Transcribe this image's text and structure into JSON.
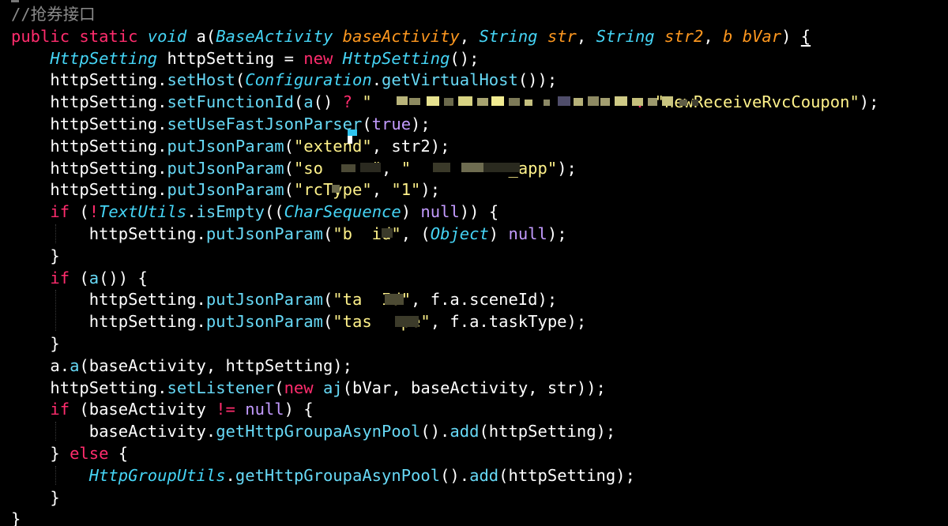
{
  "editor": {
    "background": "#000000",
    "colors": {
      "comment": "#8a8a8a",
      "keyword": "#ff2c6d",
      "type": "#45d4f5",
      "method": "#67d9f6",
      "param": "#fd971f",
      "string": "#fff28a",
      "literal": "#c39bff",
      "plain": "#ffffff"
    },
    "lines": [
      {
        "tokens": [
          {
            "t": "//抢券接口",
            "c": "comment"
          }
        ]
      },
      {
        "tokens": [
          {
            "t": "public static ",
            "c": "keyword"
          },
          {
            "t": "void ",
            "c": "type"
          },
          {
            "t": "a",
            "c": "plain"
          },
          {
            "t": "(",
            "c": "plain"
          },
          {
            "t": "BaseActivity ",
            "c": "type"
          },
          {
            "t": "baseActivity",
            "c": "param"
          },
          {
            "t": ", ",
            "c": "plain"
          },
          {
            "t": "String ",
            "c": "type"
          },
          {
            "t": "str",
            "c": "param"
          },
          {
            "t": ", ",
            "c": "plain"
          },
          {
            "t": "String ",
            "c": "type"
          },
          {
            "t": "str2",
            "c": "param"
          },
          {
            "t": ", ",
            "c": "plain"
          },
          {
            "t": "b ",
            "c": "param"
          },
          {
            "t": "bVar",
            "c": "param"
          },
          {
            "t": ") ",
            "c": "plain"
          },
          {
            "t": "{",
            "c": "plain",
            "u": true
          }
        ]
      },
      {
        "tokens": [
          {
            "t": "    ",
            "c": "plain"
          },
          {
            "t": "HttpSetting ",
            "c": "type"
          },
          {
            "t": "httpSetting = ",
            "c": "plain"
          },
          {
            "t": "new ",
            "c": "keyword"
          },
          {
            "t": "HttpSetting",
            "c": "type"
          },
          {
            "t": "();",
            "c": "plain"
          }
        ]
      },
      {
        "tokens": [
          {
            "t": "    httpSetting.",
            "c": "plain"
          },
          {
            "t": "setHost",
            "c": "method"
          },
          {
            "t": "(",
            "c": "plain"
          },
          {
            "t": "Configuration",
            "c": "type"
          },
          {
            "t": ".",
            "c": "plain"
          },
          {
            "t": "getVirtualHost",
            "c": "method"
          },
          {
            "t": "());",
            "c": "plain"
          }
        ]
      },
      {
        "tokens": [
          {
            "t": "    httpSetting.",
            "c": "plain"
          },
          {
            "t": "setFunctionId",
            "c": "method"
          },
          {
            "t": "(",
            "c": "plain"
          },
          {
            "t": "a",
            "c": "method"
          },
          {
            "t": "() ",
            "c": "plain"
          },
          {
            "t": "? ",
            "c": "keyword"
          },
          {
            "t": "\"                           ",
            "c": "string"
          },
          {
            "t": ": ",
            "c": "keyword"
          },
          {
            "t": "\"newReceiveRvcCoupon\"",
            "c": "string"
          },
          {
            "t": ");",
            "c": "plain"
          }
        ]
      },
      {
        "tokens": [
          {
            "t": "    httpSetting.",
            "c": "plain"
          },
          {
            "t": "setUseFastJsonParser",
            "c": "method"
          },
          {
            "t": "(",
            "c": "plain"
          },
          {
            "t": "true",
            "c": "literal"
          },
          {
            "t": ");",
            "c": "plain"
          }
        ]
      },
      {
        "tokens": [
          {
            "t": "    httpSetting.",
            "c": "plain"
          },
          {
            "t": "putJsonParam",
            "c": "method"
          },
          {
            "t": "(",
            "c": "plain"
          },
          {
            "t": "\"extend\"",
            "c": "string"
          },
          {
            "t": ", str2);",
            "c": "plain"
          }
        ]
      },
      {
        "tokens": [
          {
            "t": "    httpSetting.",
            "c": "plain"
          },
          {
            "t": "putJsonParam",
            "c": "method"
          },
          {
            "t": "(",
            "c": "plain"
          },
          {
            "t": "\"so     \"",
            "c": "string"
          },
          {
            "t": ", ",
            "c": "plain"
          },
          {
            "t": "\"          _app\"",
            "c": "string"
          },
          {
            "t": ");",
            "c": "plain"
          }
        ]
      },
      {
        "tokens": [
          {
            "t": "    httpSetting.",
            "c": "plain"
          },
          {
            "t": "putJsonParam",
            "c": "method"
          },
          {
            "t": "(",
            "c": "plain"
          },
          {
            "t": "\"rcType\"",
            "c": "string"
          },
          {
            "t": ", ",
            "c": "plain"
          },
          {
            "t": "\"1\"",
            "c": "string"
          },
          {
            "t": ");",
            "c": "plain"
          }
        ]
      },
      {
        "tokens": [
          {
            "t": "    ",
            "c": "plain"
          },
          {
            "t": "if ",
            "c": "keyword"
          },
          {
            "t": "(",
            "c": "plain"
          },
          {
            "t": "!",
            "c": "keyword"
          },
          {
            "t": "TextUtils",
            "c": "type"
          },
          {
            "t": ".",
            "c": "plain"
          },
          {
            "t": "isEmpty",
            "c": "method"
          },
          {
            "t": "((",
            "c": "plain"
          },
          {
            "t": "CharSequence",
            "c": "type"
          },
          {
            "t": ") ",
            "c": "plain"
          },
          {
            "t": "null",
            "c": "literal"
          },
          {
            "t": ")) {",
            "c": "plain"
          }
        ]
      },
      {
        "tokens": [
          {
            "t": "        httpSetting.",
            "c": "plain"
          },
          {
            "t": "putJsonParam",
            "c": "method"
          },
          {
            "t": "(",
            "c": "plain"
          },
          {
            "t": "\"b  id\"",
            "c": "string"
          },
          {
            "t": ", (",
            "c": "plain"
          },
          {
            "t": "Object",
            "c": "type"
          },
          {
            "t": ") ",
            "c": "plain"
          },
          {
            "t": "null",
            "c": "literal"
          },
          {
            "t": ");",
            "c": "plain"
          }
        ]
      },
      {
        "tokens": [
          {
            "t": "    }",
            "c": "plain"
          }
        ]
      },
      {
        "tokens": [
          {
            "t": "    ",
            "c": "plain"
          },
          {
            "t": "if ",
            "c": "keyword"
          },
          {
            "t": "(",
            "c": "plain"
          },
          {
            "t": "a",
            "c": "method"
          },
          {
            "t": "()) {",
            "c": "plain"
          }
        ]
      },
      {
        "tokens": [
          {
            "t": "        httpSetting.",
            "c": "plain"
          },
          {
            "t": "putJsonParam",
            "c": "method"
          },
          {
            "t": "(",
            "c": "plain"
          },
          {
            "t": "\"ta  Id\"",
            "c": "string"
          },
          {
            "t": ", f.a.sceneId);",
            "c": "plain"
          }
        ]
      },
      {
        "tokens": [
          {
            "t": "        httpSetting.",
            "c": "plain"
          },
          {
            "t": "putJsonParam",
            "c": "method"
          },
          {
            "t": "(",
            "c": "plain"
          },
          {
            "t": "\"tas   pe\"",
            "c": "string"
          },
          {
            "t": ", f.a.taskType);",
            "c": "plain"
          }
        ]
      },
      {
        "tokens": [
          {
            "t": "    }",
            "c": "plain"
          }
        ]
      },
      {
        "tokens": [
          {
            "t": "    a.",
            "c": "plain"
          },
          {
            "t": "a",
            "c": "method"
          },
          {
            "t": "(baseActivity, httpSetting);",
            "c": "plain"
          }
        ]
      },
      {
        "tokens": [
          {
            "t": "    httpSetting.",
            "c": "plain"
          },
          {
            "t": "setListener",
            "c": "method"
          },
          {
            "t": "(",
            "c": "plain"
          },
          {
            "t": "new ",
            "c": "keyword"
          },
          {
            "t": "aj",
            "c": "method"
          },
          {
            "t": "(bVar, baseActivity, str));",
            "c": "plain"
          }
        ]
      },
      {
        "tokens": [
          {
            "t": "    ",
            "c": "plain"
          },
          {
            "t": "if ",
            "c": "keyword"
          },
          {
            "t": "(baseActivity ",
            "c": "plain"
          },
          {
            "t": "!= ",
            "c": "keyword"
          },
          {
            "t": "null",
            "c": "literal"
          },
          {
            "t": ") {",
            "c": "plain"
          }
        ]
      },
      {
        "tokens": [
          {
            "t": "        baseActivity.",
            "c": "plain"
          },
          {
            "t": "getHttpGroupaAsynPool",
            "c": "method"
          },
          {
            "t": "().",
            "c": "plain"
          },
          {
            "t": "add",
            "c": "method"
          },
          {
            "t": "(httpSetting);",
            "c": "plain"
          }
        ]
      },
      {
        "tokens": [
          {
            "t": "    } ",
            "c": "plain"
          },
          {
            "t": "else ",
            "c": "keyword"
          },
          {
            "t": "{",
            "c": "plain"
          }
        ]
      },
      {
        "tokens": [
          {
            "t": "        ",
            "c": "plain"
          },
          {
            "t": "HttpGroupUtils",
            "c": "type"
          },
          {
            "t": ".",
            "c": "plain"
          },
          {
            "t": "getHttpGroupaAsynPool",
            "c": "method"
          },
          {
            "t": "().",
            "c": "plain"
          },
          {
            "t": "add",
            "c": "method"
          },
          {
            "t": "(httpSetting);",
            "c": "plain"
          }
        ]
      },
      {
        "tokens": [
          {
            "t": "    }",
            "c": "plain"
          }
        ]
      },
      {
        "tokens": [
          {
            "t": "}",
            "c": "plain"
          }
        ]
      }
    ]
  }
}
